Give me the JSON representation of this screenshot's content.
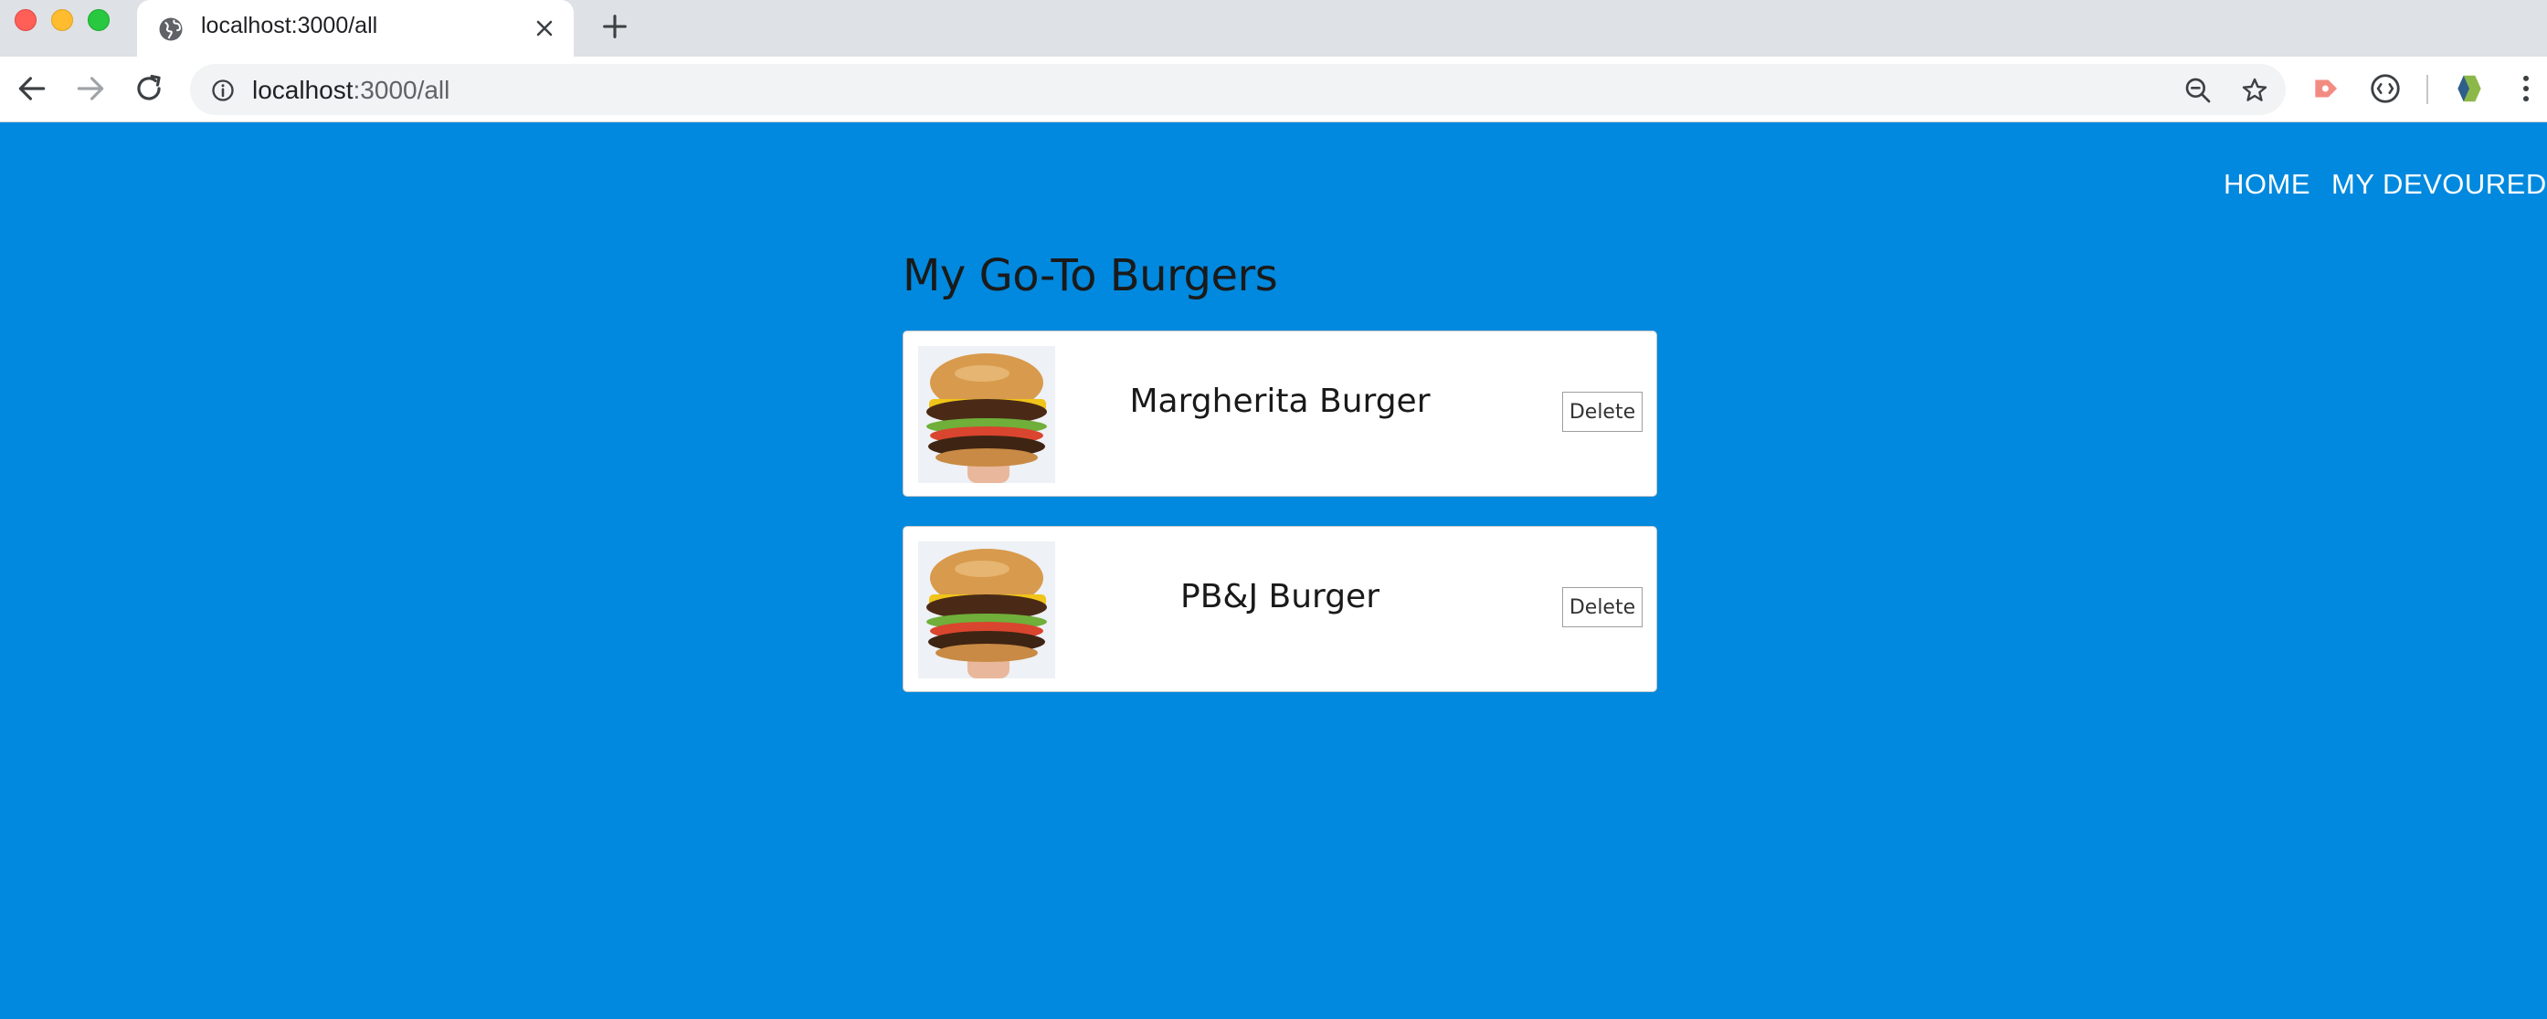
{
  "browser": {
    "tab": {
      "title": "localhost:3000/all"
    },
    "address_bar": {
      "host": "localhost",
      "path": ":3000/all"
    }
  },
  "nav": {
    "links": [
      {
        "label": "HOME"
      },
      {
        "label": "MY DEVOURED"
      }
    ]
  },
  "main": {
    "heading": "My Go-To Burgers",
    "burgers": [
      {
        "name": "Margherita Burger",
        "delete_label": "Delete"
      },
      {
        "name": "PB&J Burger",
        "delete_label": "Delete"
      }
    ]
  },
  "colors": {
    "page_background": "#0089DE",
    "card_background": "#FFFFFF",
    "nav_text": "#FFFFFF"
  }
}
